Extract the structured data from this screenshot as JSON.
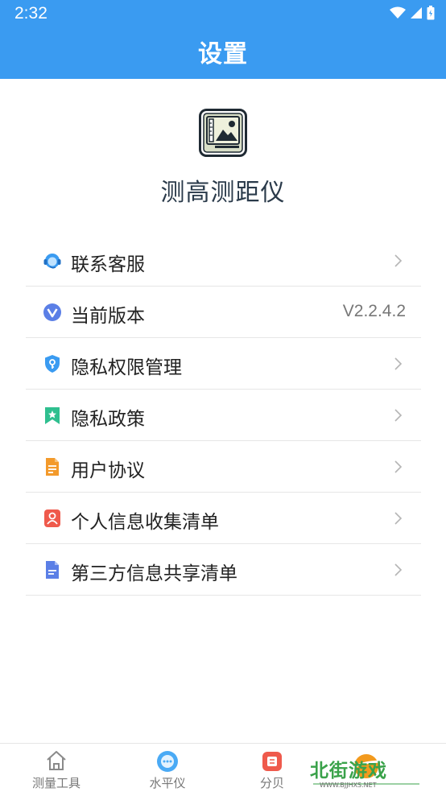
{
  "status_bar": {
    "time": "2:32"
  },
  "header": {
    "title": "设置"
  },
  "app": {
    "name": "测高测距仪"
  },
  "settings": {
    "items": [
      {
        "label": "联系客服",
        "icon": "headset-icon"
      },
      {
        "label": "当前版本",
        "icon": "version-icon",
        "value": "V2.2.4.2"
      },
      {
        "label": "隐私权限管理",
        "icon": "shield-key-icon"
      },
      {
        "label": "隐私政策",
        "icon": "bookmark-star-icon"
      },
      {
        "label": "用户协议",
        "icon": "document-icon"
      },
      {
        "label": "个人信息收集清单",
        "icon": "person-card-icon"
      },
      {
        "label": "第三方信息共享清单",
        "icon": "file-list-icon"
      }
    ]
  },
  "bottom_nav": {
    "items": [
      {
        "label": "测量工具",
        "icon": "home-icon"
      },
      {
        "label": "水平仪",
        "icon": "level-icon"
      },
      {
        "label": "分贝",
        "icon": "decibel-icon"
      }
    ]
  },
  "watermark": {
    "text": "北街游戏",
    "url": "WWW.BJJHXS.NET"
  },
  "colors": {
    "primary": "#3a9bf1",
    "divider": "#e6e6e6"
  }
}
